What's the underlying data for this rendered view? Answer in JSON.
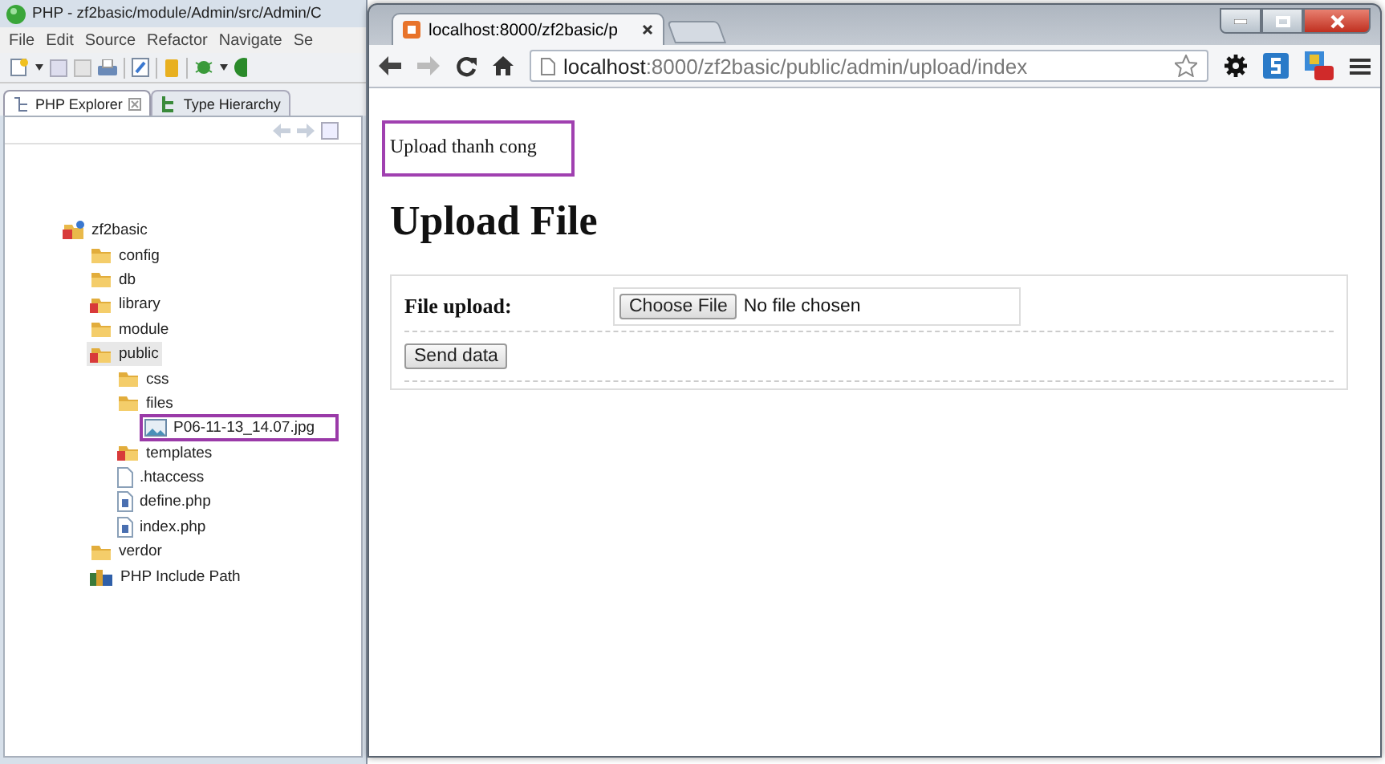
{
  "eclipse": {
    "title": "PHP - zf2basic/module/Admin/src/Admin/C",
    "menu": [
      "File",
      "Edit",
      "Source",
      "Refactor",
      "Navigate",
      "Se"
    ],
    "views": [
      {
        "label": "PHP Explorer",
        "selected": true
      },
      {
        "label": "Type Hierarchy",
        "selected": false
      }
    ],
    "tree": [
      {
        "label": "zf2basic",
        "kind": "project",
        "selected": false,
        "highlighted": false,
        "children": [
          {
            "label": "config",
            "kind": "folder",
            "selected": false,
            "highlighted": false
          },
          {
            "label": "db",
            "kind": "folder",
            "selected": false,
            "highlighted": false
          },
          {
            "label": "library",
            "kind": "marked-folder",
            "selected": false,
            "highlighted": false
          },
          {
            "label": "module",
            "kind": "folder",
            "selected": false,
            "highlighted": false
          },
          {
            "label": "public",
            "kind": "marked-folder",
            "selected": true,
            "highlighted": false,
            "children": [
              {
                "label": "css",
                "kind": "folder",
                "selected": false,
                "highlighted": false
              },
              {
                "label": "files",
                "kind": "folder",
                "selected": false,
                "highlighted": false,
                "children": [
                  {
                    "label": "P06-11-13_14.07.jpg",
                    "kind": "image",
                    "selected": false,
                    "highlighted": true
                  }
                ]
              },
              {
                "label": "templates",
                "kind": "marked-folder",
                "selected": false,
                "highlighted": false
              },
              {
                "label": ".htaccess",
                "kind": "file",
                "selected": false,
                "highlighted": false
              },
              {
                "label": "define.php",
                "kind": "php",
                "selected": false,
                "highlighted": false
              },
              {
                "label": "index.php",
                "kind": "php",
                "selected": false,
                "highlighted": false
              }
            ]
          },
          {
            "label": "verdor",
            "kind": "folder",
            "selected": false,
            "highlighted": false
          },
          {
            "label": "PHP Include Path",
            "kind": "library",
            "selected": false,
            "highlighted": false
          }
        ]
      }
    ]
  },
  "browser": {
    "tab": "localhost:8000/zf2basic/p",
    "url_host": "localhost",
    "url_rest": ":8000/zf2basic/public/admin/upload/index",
    "message": {
      "text": "Upload thanh cong",
      "highlighted": true
    },
    "heading": "Upload File",
    "form": {
      "label": "File upload:",
      "choose_button": "Choose File",
      "file_status": "No file chosen",
      "submit": "Send data"
    }
  }
}
